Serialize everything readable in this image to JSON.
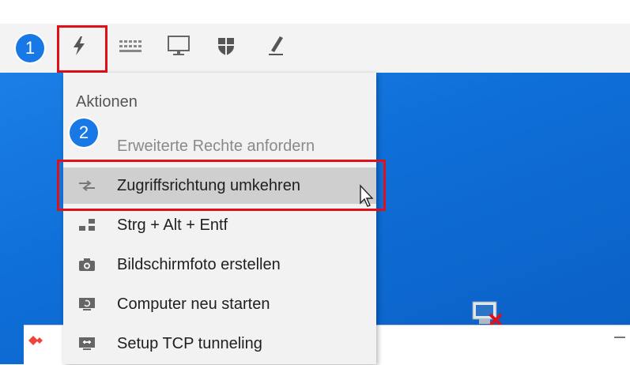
{
  "toolbar": {
    "icons": [
      "lightning-icon",
      "keyboard-icon",
      "monitor-icon",
      "shield-icon",
      "pen-icon"
    ]
  },
  "badges": {
    "one": "1",
    "two": "2"
  },
  "menu": {
    "title": "Aktionen",
    "items": [
      {
        "label": "Erweiterte Rechte anfordern",
        "icon": "none",
        "state": "disabled"
      },
      {
        "label": "Zugriffsrichtung umkehren",
        "icon": "switch-arrows-icon",
        "state": "hover"
      },
      {
        "label": "Strg + Alt + Entf",
        "icon": "keys-icon",
        "state": "normal"
      },
      {
        "label": "Bildschirmfoto erstellen",
        "icon": "camera-icon",
        "state": "normal"
      },
      {
        "label": "Computer neu starten",
        "icon": "restart-icon",
        "state": "normal"
      },
      {
        "label": "Setup TCP tunneling",
        "icon": "tunnel-icon",
        "state": "normal"
      }
    ]
  },
  "colors": {
    "highlight": "#e0101a",
    "badge": "#1778e6",
    "desktop": "#0f6fd8",
    "hover": "#cfcfcf"
  }
}
